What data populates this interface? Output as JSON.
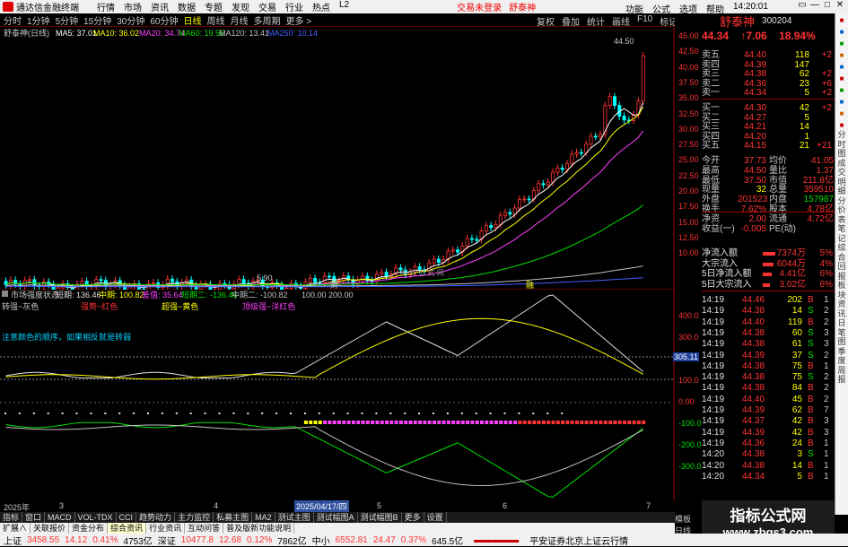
{
  "titlebar": {
    "app": "通达信金融终端",
    "menus": [
      "行情",
      "市场",
      "资讯",
      "数据",
      "专题",
      "发现",
      "交易",
      "行业",
      "热点",
      "L2"
    ],
    "login1": "交易未登录",
    "login2": "舒泰神",
    "right": [
      "功能",
      "公式",
      "选项",
      "帮助"
    ],
    "clock": "14:20:01",
    "wctl": [
      "▭",
      "—",
      "□",
      "✕"
    ]
  },
  "periods": [
    "分时",
    "1分钟",
    "5分钟",
    "15分钟",
    "30分钟",
    "60分钟",
    "日线",
    "周线",
    "月线",
    "多周期",
    "更多 >"
  ],
  "toolbar_right": [
    "复权",
    "叠加",
    "统计",
    "画线",
    "F10",
    "标记",
    "返回"
  ],
  "stock": {
    "name": "舒泰神",
    "code": "300204",
    "price": "44.34",
    "change": "↑7.06",
    "pct": "18.94%"
  },
  "ma_line": {
    "title": "舒泰神(日线)",
    "ma5": "MA5: 37.01",
    "ma10": "MA10: 36.02",
    "ma20": "MA20: 34.74",
    "ma60": "MA60: 19.55",
    "ma120": "MA120: 13.41",
    "ma250": "MA250: 10.14"
  },
  "price_annot": {
    "high": "44.50",
    "low": "5.90",
    "watermark": "指 标 公 式 网"
  },
  "price_axis": [
    "45.00",
    "42.50",
    "40.00",
    "37.50",
    "35.00",
    "32.50",
    "30.00",
    "27.50",
    "25.00",
    "22.50",
    "20.00",
    "17.50",
    "15.00",
    "12.50",
    "10.00"
  ],
  "ind": {
    "title": "市场强度状态",
    "v1": "短期: 136.46",
    "v2": "中期: 100.82",
    "v3": "差值: 35.64",
    "v4": "短期二: -136.46",
    "v5": "中期二: -100.82",
    "v6": "100.00",
    "v7": "200.00",
    "l1": "转强~灰色",
    "l2": "强势~红色",
    "l3": "超强~黄色",
    "l4": "顶级强~洋红色",
    "note": "注意颜色的顺序，如果相反就是转弱",
    "cur": "305.11"
  },
  "ind_axis": [
    "400.0",
    "300.0",
    "200.0",
    "100.0",
    "0.00",
    "-100.0",
    "-200.0",
    "-300.0"
  ],
  "xaxis": [
    "2025年",
    "3",
    "4",
    "2025/04/17/四",
    "5",
    "6",
    "7",
    "日线"
  ],
  "orderbook": {
    "sell": [
      [
        "卖五",
        "44.40",
        "118",
        "+2"
      ],
      [
        "卖四",
        "44.39",
        "147",
        ""
      ],
      [
        "卖三",
        "44.38",
        "62",
        "+2"
      ],
      [
        "卖二",
        "44.36",
        "23",
        "+6"
      ],
      [
        "卖一",
        "44.34",
        "5",
        "+2"
      ]
    ],
    "buy": [
      [
        "买一",
        "44.30",
        "42",
        "+2"
      ],
      [
        "买二",
        "44.27",
        "5",
        ""
      ],
      [
        "买三",
        "44.21",
        "14",
        ""
      ],
      [
        "买四",
        "44.20",
        "1",
        ""
      ],
      [
        "买五",
        "44.15",
        "21",
        "+21"
      ]
    ]
  },
  "stats": [
    [
      "今开",
      "37.73",
      "均价",
      "41.05"
    ],
    [
      "最高",
      "44.50",
      "量比",
      "1.37"
    ],
    [
      "最低",
      "37.50",
      "市值",
      "211.8亿"
    ],
    [
      "现量",
      "32",
      "总量",
      "359510"
    ],
    [
      "外盘",
      "201523",
      "内盘",
      "157987"
    ],
    [
      "换手",
      "7.62%",
      "股本",
      "4.78亿"
    ],
    [
      "净资",
      "2.00",
      "流通",
      "4.72亿"
    ],
    [
      "收益(一)",
      "-0.005",
      "PE(动)",
      ""
    ]
  ],
  "flows": [
    [
      "净流入额",
      "7374万",
      "5%"
    ],
    [
      "大宗流入",
      "6044万",
      "4%"
    ],
    [
      "5日净流入额",
      "4.41亿",
      "6%"
    ],
    [
      "5日大宗流入",
      "3.02亿",
      "6%"
    ]
  ],
  "ticks": [
    [
      "14:19",
      "44.46",
      "202",
      "B",
      "1"
    ],
    [
      "14:19",
      "44.38",
      "14",
      "S",
      "2"
    ],
    [
      "14:19",
      "44.40",
      "119",
      "B",
      "2"
    ],
    [
      "14:19",
      "44.38",
      "60",
      "S",
      "3"
    ],
    [
      "14:19",
      "44.38",
      "61",
      "S",
      "3"
    ],
    [
      "14:19",
      "44.39",
      "37",
      "S",
      "2"
    ],
    [
      "14:19",
      "44.38",
      "75",
      "B",
      "1"
    ],
    [
      "14:19",
      "44.38",
      "75",
      "S",
      "2"
    ],
    [
      "14:19",
      "44.38",
      "84",
      "B",
      "2"
    ],
    [
      "14:19",
      "44.40",
      "45",
      "B",
      "2"
    ],
    [
      "14:19",
      "44.39",
      "62",
      "B",
      "7"
    ],
    [
      "14:19",
      "44.37",
      "42",
      "B",
      "3"
    ],
    [
      "14:19",
      "44.39",
      "42",
      "B",
      "3"
    ],
    [
      "14:19",
      "44.36",
      "24",
      "B",
      "1"
    ],
    [
      "14:20",
      "44.38",
      "3",
      "S",
      "1"
    ],
    [
      "14:20",
      "44.38",
      "14",
      "B",
      "1"
    ],
    [
      "14:20",
      "44.34",
      "5",
      "B",
      "1"
    ]
  ],
  "bottom_tabs": [
    "指标",
    "窗口",
    "MACD",
    "VOL-TDX",
    "CCI",
    "趋势动力",
    "主力监控",
    "私募主图",
    "MA2",
    "测试主图",
    "测试幅图A",
    "测试幅图B",
    "更多",
    "设置"
  ],
  "bottom_tabs2": [
    "扩展∧",
    "关联报价",
    "资金分布",
    "综合资讯",
    "行业资讯",
    "互动问答",
    "普及版新功能说明"
  ],
  "right_tabs": [
    "模板",
    "日线"
  ],
  "status": {
    "a": "上证",
    "a1": "3458.55",
    "a2": "14.12",
    "a3": "0.41%",
    "a4": "4753亿",
    "b": "深证",
    "b1": "10477.8",
    "b2": "12.68",
    "b3": "0.12%",
    "b4": "7862亿",
    "c": "中小",
    "c1": "6552.81",
    "c2": "24.47",
    "c3": "0.37%",
    "c4": "645.5亿",
    "d": "平安证券北京上证云行情"
  },
  "brand": "指标公式网",
  "brand_url": "www.zbgs3.com",
  "sidebar": [
    "分",
    "时",
    "图",
    "成",
    "交",
    "明",
    "细",
    "分",
    "价",
    "表",
    "笔",
    "记",
    "综",
    "合",
    "回",
    "报",
    "板",
    "块",
    "资",
    "讯",
    "日",
    "笔",
    "图",
    "季",
    "度",
    "周",
    "报"
  ],
  "colors": {
    "up": "#ff3333",
    "down": "#00ffff",
    "ma5": "#ffffff",
    "ma10": "#ffff00",
    "ma20": "#ff40ff",
    "ma60": "#00e000",
    "ma120": "#c0c0c0",
    "ma250": "#4060ff"
  }
}
